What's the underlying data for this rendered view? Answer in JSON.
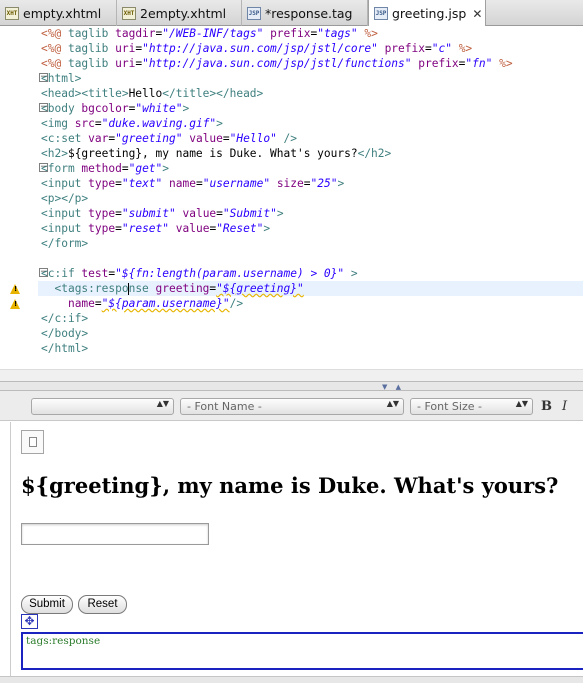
{
  "tabs": [
    {
      "label": "empty.xhtml",
      "icon": "xhtml-file-icon",
      "active": false
    },
    {
      "label": "2empty.xhtml",
      "icon": "xhtml-file-icon",
      "active": false
    },
    {
      "label": "*response.tag",
      "icon": "tag-file-icon",
      "active": false
    },
    {
      "label": "greeting.jsp",
      "icon": "jsp-file-icon",
      "active": true,
      "close": "✕"
    }
  ],
  "icon_glyphs": {
    "xhtml": "XHT",
    "jsp": "JSP"
  },
  "editor": {
    "tok": [
      "<%@",
      " taglib ",
      "tagdir",
      "=",
      "\"/WEB-INF/tags\"",
      " prefix",
      "=",
      "\"tags\"",
      " %>",
      " taglib ",
      "uri",
      "=",
      "\"http://java.sun.com/jsp/jstl/core\"",
      " prefix",
      "=",
      "\"c\"",
      "\"http://java.sun.com/jsp/jstl/functions\"",
      "\"fn\"",
      "<html>",
      "<head><title>",
      "Hello",
      "</title></head>",
      "<body",
      " bgcolor",
      "=",
      "\"white\"",
      ">",
      "<img",
      " src",
      "\"duke.waving.gif\"",
      "<c:set",
      " var",
      "\"greeting\"",
      " value",
      "\"Hello\"",
      " />",
      "<h2>",
      "${greeting}, my name is Duke. What's yours?",
      "</h2>",
      "<form",
      " method",
      "\"get\"",
      "<input",
      " type",
      "\"text\"",
      " name",
      "\"username\"",
      " size",
      "\"25\"",
      "<p></p>",
      "\"submit\"",
      "\"Submit\"",
      "\"reset\"",
      "\"Reset\"",
      "</form>",
      "<c:if",
      " test",
      "\"${fn:length(param.username) > 0}\"",
      " >",
      "<tags:respo",
      "nse",
      " greeting",
      "\"${greeting}\"",
      "name",
      "\"${param.username}\"",
      "/>",
      "</c:if>",
      "</body>",
      "</html>"
    ],
    "fold_collapse": "−",
    "warning_glyph": "!"
  },
  "sash_arrows": "▼ ▲",
  "toolbar": {
    "style_value": "",
    "font_name_placeholder": "- Font Name -",
    "font_size_placeholder": "- Font Size -",
    "stepper": "▲▼",
    "bold": "B",
    "italic": "I"
  },
  "preview": {
    "heading": "${greeting}, my name is Duke. What's yours?",
    "text_input_value": "",
    "submit": "Submit",
    "reset": "Reset",
    "move_handle": "✥",
    "tag_label": "tags:response"
  }
}
